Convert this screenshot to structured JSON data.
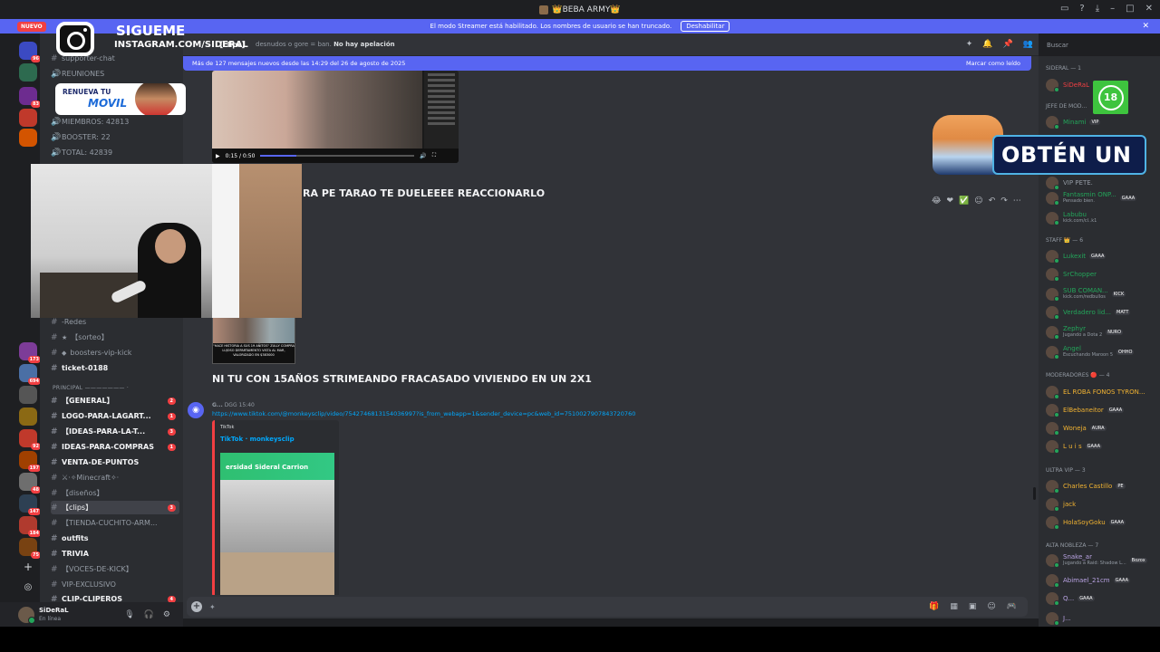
{
  "window": {
    "title": "👑BEBA ARMY👑"
  },
  "streamer": {
    "text": "El modo Streamer está habilitado. Los nombres de usuario se han truncado.",
    "disable": "Deshabilitar"
  },
  "rail": {
    "nuevo": "NUEVO",
    "badges": [
      "96",
      "83",
      "173",
      "694",
      "92",
      "197",
      "48",
      "147",
      "184",
      "75"
    ]
  },
  "sidebar": {
    "server_name": "BEBA ARMY",
    "channels": [
      {
        "label": "supporter-chat"
      },
      {
        "label": "REUNIONES"
      },
      {
        "label": "MIEMBROS: 42813"
      },
      {
        "label": "BOOSTER: 22"
      },
      {
        "label": "TOTAL: 42839"
      },
      {
        "label": "-Redes"
      },
      {
        "label": "【sorteo】"
      },
      {
        "label": "boosters-vip-kick"
      },
      {
        "label": "ticket-0188"
      }
    ],
    "category": "PRINCIPAL ——————— ·",
    "principal": [
      {
        "label": "【GENERAL】",
        "badge": "2"
      },
      {
        "label": "LOGO-PARA-LAGART...",
        "badge": "1"
      },
      {
        "label": "【IDEAS-PARA-LA-T...",
        "badge": "3"
      },
      {
        "label": "IDEAS-PARA-COMPRAS",
        "badge": "1"
      },
      {
        "label": "VENTA-DE-PUNTOS",
        "badge": ""
      },
      {
        "label": "⚔·✧Minecraft✧·",
        "badge": ""
      },
      {
        "label": "【diseños】",
        "badge": ""
      },
      {
        "label": "【clips】",
        "badge": "3"
      },
      {
        "label": "【TIENDA-CUCHITO-ARM...",
        "badge": ""
      },
      {
        "label": "outfits",
        "badge": ""
      },
      {
        "label": "TRIVIA",
        "badge": ""
      },
      {
        "label": "【VOCES-DE-KICK】",
        "badge": ""
      },
      {
        "label": "VIP-EXCLUSIVO",
        "badge": ""
      },
      {
        "label": "CLIP-CLIPEROS",
        "badge": "4"
      }
    ]
  },
  "user": {
    "name": "SiDeRaL",
    "status": "En línea"
  },
  "header": {
    "channel": "【clips】",
    "topic_prefix": "desnudos o gore = ban.",
    "topic_bold": "No hay apelación"
  },
  "search": {
    "placeholder": "Buscar"
  },
  "main": {
    "newbar": "Más de 127 mensajes nuevos desde las 14:29 del 26 de agosto de 2025",
    "mark_read": "Marcar como leído",
    "video_time": "0:15 / 0:50",
    "msg1": "RA PE TARAO TE DUELEEEE REACCIONARLO",
    "thumb_caption": "\"HACE HISTORIA A SUS 19 AÑITOS\" ZULLY COMPRA LUJOSO DEPARTAMENTO VISTA AL MAR, VALORIZADO EN $383000",
    "msg2": "NI TU CON 15AÑOS STRIMEANDO FRACASADO VIVIENDO EN UN 2X1",
    "author": "G...",
    "author_tag": "DGG",
    "time": "15:40",
    "link": "https://www.tiktok.com/@monkeysclip/video/7542746813154036997?is_from_webapp=1&sender_device=pc&web_id=7510027907843720760",
    "embed_provider": "TikTok",
    "embed_title": "TikTok · monkeysclip",
    "embed_image_text": "ersidad Sideral Carrion"
  },
  "members": {
    "groups": [
      {
        "title": "SIDERAL — 1"
      },
      {
        "title": "JEFE DE MOD..."
      },
      {
        "title": "STAFF 👑 — 6"
      },
      {
        "title": "MODERADORES 🔴 — 4"
      },
      {
        "title": "ULTRA VIP — 3"
      },
      {
        "title": "ALTA NOBLEZA — 7"
      }
    ],
    "list": [
      {
        "name": "SiDeRaL",
        "sub": "",
        "tag": "",
        "color": "#f23f42"
      },
      {
        "name": "Minami",
        "sub": "",
        "tag": "VIP",
        "color": "#23a55a"
      },
      {
        "name": "VIP PETE.",
        "sub": "",
        "tag": "",
        "color": "#949ba4"
      },
      {
        "name": "Fantasmin ONP...",
        "sub": "Pensado bien.",
        "tag": "GAAA",
        "color": "#23a55a"
      },
      {
        "name": "Labubu",
        "sub": "kick.com/cl..k1",
        "tag": "",
        "color": "#23a55a"
      },
      {
        "name": "Lukexit",
        "sub": "",
        "tag": "GAAA",
        "color": "#23a55a"
      },
      {
        "name": "SrChopper",
        "sub": "",
        "tag": "",
        "color": "#23a55a"
      },
      {
        "name": "SUB COMAN...",
        "sub": "kick.com/redbullos",
        "tag": "KICK",
        "color": "#23a55a"
      },
      {
        "name": "Verdadero lid...",
        "sub": "",
        "tag": "MATT",
        "color": "#23a55a"
      },
      {
        "name": "Zephyr",
        "sub": "Jugando a Dota 2",
        "tag": "NURO",
        "color": "#23a55a"
      },
      {
        "name": "Angel",
        "sub": "Escuchando Maroon 5",
        "tag": "OHHO",
        "color": "#23a55a"
      },
      {
        "name": "EL ROBA FONOS TYRON...",
        "sub": "",
        "tag": "",
        "color": "#f0b232"
      },
      {
        "name": "ElBebaneitor",
        "sub": "",
        "tag": "GAAA",
        "color": "#f0b232"
      },
      {
        "name": "Woneja",
        "sub": "",
        "tag": "AURA",
        "color": "#f0b232"
      },
      {
        "name": "L u i s",
        "sub": "",
        "tag": "GAAA",
        "color": "#f0b232"
      },
      {
        "name": "Charles Castillo",
        "sub": "",
        "tag": "PE",
        "color": "#f0b232"
      },
      {
        "name": "jack",
        "sub": "",
        "tag": "",
        "color": "#f0b232"
      },
      {
        "name": "HolaSoyGoku",
        "sub": "",
        "tag": "GAAA",
        "color": "#f0b232"
      },
      {
        "name": "Snake_ar",
        "sub": "Jugando a Raid: Shadow L...",
        "tag": "Bozox",
        "color": "#b9a3e3"
      },
      {
        "name": "Abimael_21cm",
        "sub": "",
        "tag": "GAAA",
        "color": "#b9a3e3"
      },
      {
        "name": "Q...",
        "sub": "",
        "tag": "GAAA",
        "color": "#b9a3e3"
      },
      {
        "name": "J...",
        "sub": "",
        "tag": "",
        "color": "#b9a3e3"
      }
    ]
  },
  "overlays": {
    "sigueme": "SIGUEME",
    "instagram": "INSTAGRAM.COM/SIDERAL",
    "renueva": "RENUEVA TU",
    "movil": "MOVIL",
    "age": "18",
    "obten": "OBTÉN UN"
  }
}
